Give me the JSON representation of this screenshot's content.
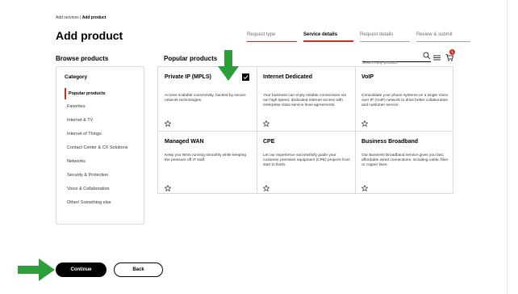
{
  "breadcrumb": {
    "parent": "Add services",
    "separator": " | ",
    "current": "Add product"
  },
  "page_title": "Add product",
  "steps": [
    {
      "label": "Request type",
      "state": "done"
    },
    {
      "label": "Service details",
      "state": "active"
    },
    {
      "label": "Request details",
      "state": "pending"
    },
    {
      "label": "Review & submit",
      "state": "pending"
    }
  ],
  "browse": {
    "title": "Browse products"
  },
  "popular": {
    "title": "Popular products"
  },
  "search": {
    "placeholder": "Search any product",
    "value": ""
  },
  "cart": {
    "badge_count": "1"
  },
  "category": {
    "heading": "Category",
    "items": [
      {
        "label": "Popular products",
        "active": true
      },
      {
        "label": "Favorites"
      },
      {
        "label": "Internet & TV"
      },
      {
        "label": "Internet of Things"
      },
      {
        "label": "Contact Center & CX Solutions"
      },
      {
        "label": "Networks"
      },
      {
        "label": "Security & Protection"
      },
      {
        "label": "Voice & Collaboration"
      },
      {
        "label": "Other/ Something else"
      }
    ]
  },
  "products": [
    {
      "title": "Private IP (MPLS)",
      "desc": "Access scalable connectivity, backed by secure network technologies.",
      "selected": true
    },
    {
      "title": "Internet Dedicated",
      "desc": "Your business can enjoy reliable connections via our high-speed, dedicated internet access with enterprise-class service level agreements."
    },
    {
      "title": "VoIP",
      "desc": "Consolidate your phone systems on a single Voice over IP (VoIP) network to drive better collaboration and customer service."
    },
    {
      "title": "Managed WAN",
      "desc": "Keep you WAN running smoothly while keeping the pressure off IT staff."
    },
    {
      "title": "CPE",
      "desc": "Let our experience successfully guide your customer premises equipment (CPE) projects from start to finish."
    },
    {
      "title": "Business Broadband",
      "desc": "Our Business Broadband service gives you fast, affordable wired connections, including cable, fiber or copper lines."
    }
  ],
  "buttons": {
    "continue": "Continue",
    "back": "Back"
  },
  "colors": {
    "accent": "#d52b1e",
    "arrow": "#2e9e3a",
    "primary": "#000000"
  },
  "icons": {
    "search": "search-icon",
    "list": "list-icon",
    "cart": "cart-icon",
    "star": "star-icon",
    "check": "checkbox-checked-icon"
  }
}
